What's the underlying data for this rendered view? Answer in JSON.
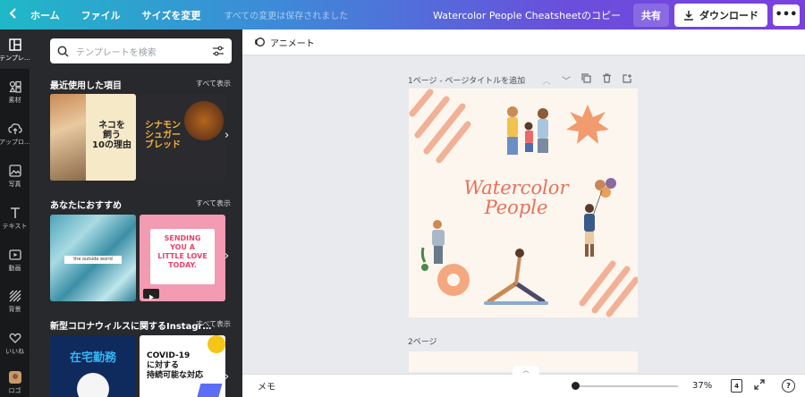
{
  "topbar": {
    "back_icon": "chevron-left-icon",
    "home": "ホーム",
    "file": "ファイル",
    "resize": "サイズを変更",
    "save_status": "すべての変更は保存されました",
    "doc_title": "Watercolor People Cheatsheetのコピー",
    "share": "共有",
    "download": "ダウンロード",
    "more": "•••"
  },
  "rail": {
    "items": [
      {
        "label": "テンプレ…",
        "icon": "template-icon"
      },
      {
        "label": "素材",
        "icon": "elements-icon"
      },
      {
        "label": "アップロ…",
        "icon": "upload-icon"
      },
      {
        "label": "写真",
        "icon": "photo-icon"
      },
      {
        "label": "テキスト",
        "icon": "text-icon"
      },
      {
        "label": "動画",
        "icon": "video-icon"
      },
      {
        "label": "背景",
        "icon": "background-icon"
      },
      {
        "label": "いいね",
        "icon": "heart-icon"
      },
      {
        "label": "ロゴ",
        "icon": "logo-icon"
      }
    ]
  },
  "panel": {
    "search_placeholder": "テンプレートを検索",
    "sections": [
      {
        "title": "最近使用した項目",
        "see_all": "すべて表示",
        "thumbs": [
          {
            "lines": [
              "ネコを",
              "飼う",
              "10の理由"
            ]
          },
          {
            "lines": [
              "シナモン",
              "シュガー",
              "ブレッド"
            ]
          }
        ]
      },
      {
        "title": "あなたにおすすめ",
        "see_all": "すべて表示",
        "thumbs": [
          {
            "lines": [
              "the outside world"
            ]
          },
          {
            "lines": [
              "SENDING",
              "YOU A",
              "LITTLE LOVE",
              "TODAY."
            ]
          }
        ]
      },
      {
        "title": "新型コロナウィルスに関するInstagr…",
        "see_all": "すべて表示",
        "thumbs": [
          {
            "lines": [
              "在宅勤務"
            ]
          },
          {
            "lines": [
              "COVID-19",
              "に対する",
              "持続可能な対応"
            ]
          }
        ]
      }
    ]
  },
  "canvas": {
    "animate_label": "アニメート",
    "page1_label": "1ページ - ページタイトルを追加",
    "page2_label": "2ページ",
    "design_title_line1": "Watercolor",
    "design_title_line2": "People"
  },
  "bottombar": {
    "memo": "メモ",
    "zoom": "37%",
    "page_count": "4",
    "help": "?"
  },
  "colors": {
    "accent_gradient_start": "#1fb8c7",
    "accent_gradient_end": "#7b3fe0",
    "panel_bg": "#28292c",
    "design_bg": "#fdf6ee",
    "design_accent": "#e87058"
  }
}
